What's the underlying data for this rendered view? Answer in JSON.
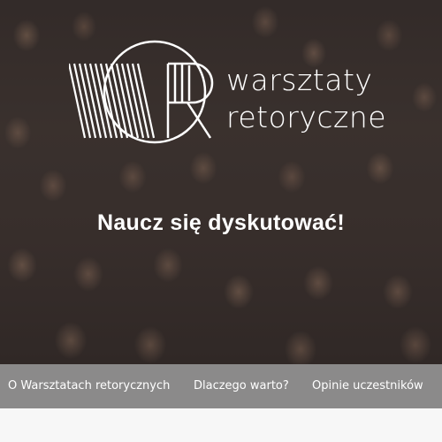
{
  "hero": {
    "logo_line1": "warsztaty",
    "logo_line2": "retoryczne",
    "headline": "Naucz się dyskutować!"
  },
  "nav": {
    "items": [
      {
        "label": "O Warsztatach retorycznych"
      },
      {
        "label": "Dlaczego warto?"
      },
      {
        "label": "Opinie uczestników"
      }
    ]
  },
  "colors": {
    "nav_background": "#8b8a8a",
    "text": "#ffffff"
  }
}
